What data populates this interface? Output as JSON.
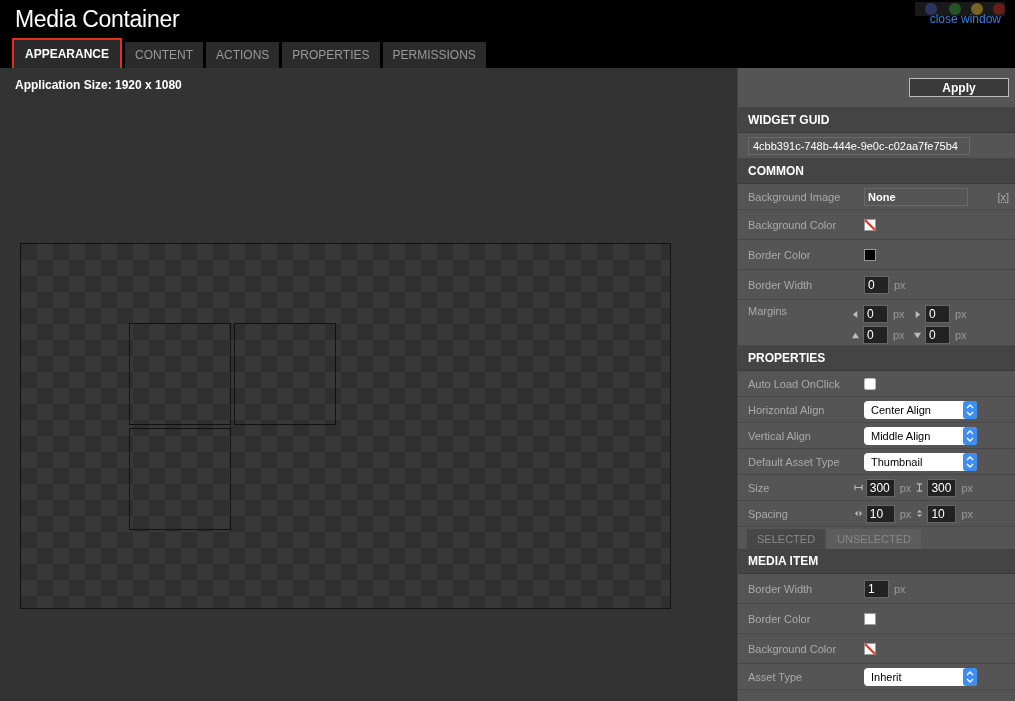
{
  "window": {
    "title": "Media Container",
    "close_link": "close window"
  },
  "tabs": [
    {
      "label": "APPEARANCE",
      "selected": true
    },
    {
      "label": "CONTENT",
      "selected": false
    },
    {
      "label": "ACTIONS",
      "selected": false
    },
    {
      "label": "PROPERTIES",
      "selected": false
    },
    {
      "label": "PERMISSIONS",
      "selected": false
    }
  ],
  "app_size": "Application Size: 1920 x 1080",
  "panel": {
    "apply_button": "Apply",
    "sections": [
      {
        "title": "WIDGET GUID",
        "rows": [
          {
            "kind": "guid",
            "value": "4cbb391c-748b-444e-9e0c-c02aa7fe75b4"
          }
        ]
      },
      {
        "title": "COMMON",
        "rows": [
          {
            "kind": "text",
            "label": "Background Image",
            "value": "None",
            "clear": "[x]"
          },
          {
            "kind": "swatch",
            "label": "Background Color",
            "transparent": true
          },
          {
            "kind": "swatch",
            "label": "Border Color",
            "transparent": false,
            "color": "#000000"
          },
          {
            "kind": "number",
            "label": "Border Width",
            "value": "0",
            "unit": "px"
          },
          {
            "kind": "quad",
            "label": "Margins",
            "fields": [
              {
                "value": "0",
                "unit": "px"
              },
              {
                "value": "0",
                "unit": "px"
              },
              {
                "value": "0",
                "unit": "px"
              },
              {
                "value": "0",
                "unit": "px"
              }
            ]
          }
        ]
      },
      {
        "title": "PROPERTIES",
        "rows": [
          {
            "kind": "checkbox",
            "label": "Auto Load OnClick",
            "checked": false
          },
          {
            "kind": "select",
            "label": "Horizontal Align",
            "value": "Center Align"
          },
          {
            "kind": "select",
            "label": "Vertical Align",
            "value": "Middle Align"
          },
          {
            "kind": "select",
            "label": "Default Asset Type",
            "value": "Thumbnail"
          },
          {
            "kind": "size",
            "label": "Size",
            "fields": [
              {
                "value": "300",
                "unit": "px"
              },
              {
                "value": "300",
                "unit": "px"
              }
            ]
          },
          {
            "kind": "spacing",
            "label": "Spacing",
            "fields": [
              {
                "value": "10",
                "unit": "px"
              },
              {
                "value": "10",
                "unit": "px"
              }
            ]
          }
        ],
        "subtabs": [
          {
            "label": "SELECTED",
            "selected": true
          },
          {
            "label": "UNSELECTED",
            "selected": false
          }
        ]
      },
      {
        "title": "MEDIA ITEM",
        "rows": [
          {
            "kind": "number",
            "label": "Border Width",
            "value": "1",
            "unit": "px"
          },
          {
            "kind": "swatch",
            "label": "Border Color",
            "transparent": false,
            "color": "#ffffff"
          },
          {
            "kind": "swatch",
            "label": "Background Color",
            "transparent": true
          },
          {
            "kind": "select",
            "label": "Asset Type",
            "value": "Inherit"
          }
        ]
      }
    ]
  }
}
